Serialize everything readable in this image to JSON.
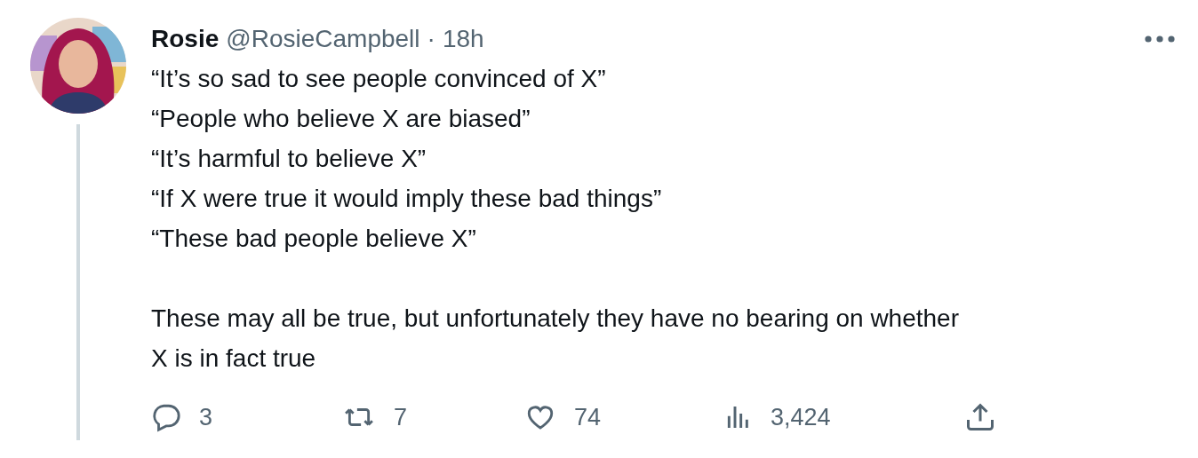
{
  "tweet": {
    "author_name": "Rosie",
    "handle": "@RosieCampbell",
    "separator": "·",
    "time": "18h",
    "paragraphs": [
      [
        "“It’s so sad to see people convinced of X”",
        "“People who believe X are biased”",
        "“It’s harmful to believe X”",
        "“If X were true it would imply these bad things”",
        "“These bad people believe X”"
      ],
      [
        "These may all be true, but unfortunately they have no bearing on whether",
        "X is in fact true"
      ]
    ],
    "actions": [
      {
        "kind": "reply",
        "count": "3"
      },
      {
        "kind": "retweet",
        "count": "7"
      },
      {
        "kind": "like",
        "count": "74"
      },
      {
        "kind": "views",
        "count": "3,424"
      },
      {
        "kind": "share"
      }
    ]
  }
}
